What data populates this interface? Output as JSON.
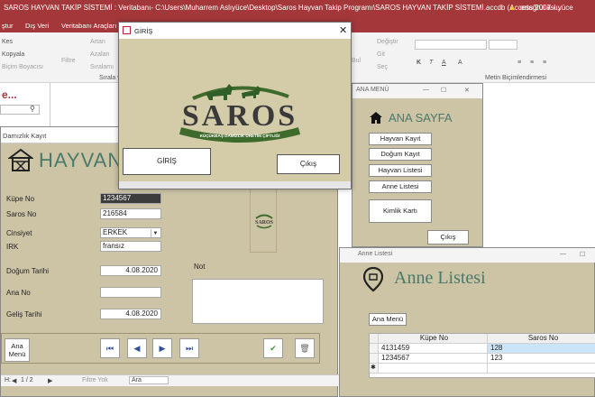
{
  "app": {
    "title": "SAROS HAYVAN TAKİP SİSTEMİ : Veritabanı- C:\\Users\\Muharrem Aslıyüce\\Desktop\\Saros Hayvan Takip Programı\\SAROS HAYVAN TAKİP SİSTEMİ.accdb (Access 2007 -...",
    "user": "ertuğrul aslıyüce",
    "colors": {
      "access_red": "#a4373a",
      "form_bg": "#cdc4a6",
      "title_green": "#4a7a6a"
    }
  },
  "menu": [
    "ştur",
    "Dış Veri",
    "Veritabanı Araçları"
  ],
  "ribbon": {
    "clipboard": [
      "Kes",
      "Kopyala",
      "Biçim Boyacısı"
    ],
    "filter_label": "Filtre",
    "sort": [
      "Artan",
      "Azalan",
      "Sıralamı"
    ],
    "sort_group": "Sırala ve",
    "records": [
      "Değiştir",
      "Git",
      "Seç"
    ],
    "find": "Bul",
    "text_format_group": "Metin Biçimlendirmesi"
  },
  "navpane": {
    "title": "e..."
  },
  "form_damizlik": {
    "tab_title": "Damızlık Kayıt",
    "title": "HAYVAN",
    "fields": {
      "kupe_no": {
        "label": "Küpe No",
        "value": "1234567"
      },
      "saros_no": {
        "label": "Saros No",
        "value": "216584"
      },
      "cinsiyet": {
        "label": "Cinsiyet",
        "value": "ERKEK"
      },
      "irk": {
        "label": "IRK",
        "value": "fransız"
      },
      "dogum_tarihi": {
        "label": "Doğum Tarihi",
        "value": "4.08.2020"
      },
      "ana_no": {
        "label": "Ana No",
        "value": ""
      },
      "gelis_tarihi": {
        "label": "Geliş Tarihi",
        "value": "4.08.2020"
      },
      "not": {
        "label": "Not",
        "value": ""
      }
    },
    "ana_menu_button": "Ana Menü",
    "logo_text": "SAROS",
    "record_nav": {
      "prefix": "H:",
      "position": "1 / 2",
      "filter": "Filtre Yok",
      "search": "Ara"
    }
  },
  "dialog_giris": {
    "title": "GİRİŞ",
    "logo_text": "SAROS",
    "logo_tagline": "KÜÇÜKBAŞ DAMIZLIK ÜRETİM ÇİFTLİĞİ",
    "login_button": "GİRİŞ",
    "exit_button": "Çıkış",
    "close_glyph": "✕"
  },
  "window_ana_menu": {
    "title": "ANA MENÜ",
    "heading": "ANA SAYFA",
    "buttons": [
      "Hayvan Kayıt",
      "Doğum Kayıt",
      "Hayvan Listesi",
      "Anne Listesi",
      "Kimlik Kartı"
    ],
    "exit_button": "Çıkış",
    "controls": [
      "—",
      "☐",
      "✕"
    ]
  },
  "window_anne_listesi": {
    "title": "Anne Listesi",
    "heading": "Anne Listesi",
    "ana_menu_button": "Ana Menü",
    "columns": [
      "Küpe No",
      "Saros No"
    ],
    "rows": [
      [
        "4131459",
        "128"
      ],
      [
        "1234567",
        "123"
      ]
    ],
    "new_row_marker": "✱"
  }
}
